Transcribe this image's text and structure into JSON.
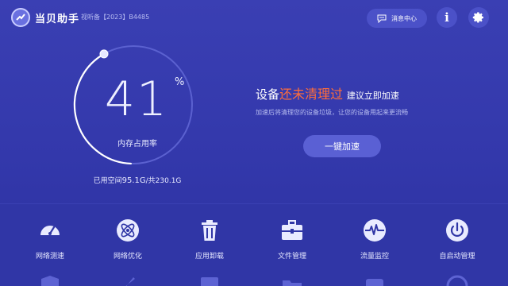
{
  "header": {
    "app_title": "当贝助手",
    "license": "视听备【2023】B4485",
    "messages_label": "消息中心",
    "info_label": "i"
  },
  "memory": {
    "percent_value": "41",
    "percent_sign": "%",
    "usage_fraction": 0.41,
    "label": "内存占用率",
    "used_prefix": "已用空间",
    "used_value": "95.1G",
    "used_sep": "/共",
    "total_value": "230.1G"
  },
  "status": {
    "part1": "设备",
    "warn": "还未清理过",
    "part2": "建议立即加速",
    "subtitle": "加速后将清理您的设备垃圾，让您的设备用起来更流畅",
    "button_label": "一键加速"
  },
  "tools": [
    {
      "label": "网络测速",
      "icon": "speedometer-icon"
    },
    {
      "label": "网络优化",
      "icon": "atom-icon"
    },
    {
      "label": "应用卸载",
      "icon": "trash-icon"
    },
    {
      "label": "文件管理",
      "icon": "toolbox-icon"
    },
    {
      "label": "流量监控",
      "icon": "pulse-icon"
    },
    {
      "label": "自启动管理",
      "icon": "power-icon"
    }
  ],
  "colors": {
    "background": "#3338ab",
    "accent_warn": "#ff6d3a",
    "gauge_track": "#5b61d0",
    "gauge_fill": "#ffffff"
  }
}
